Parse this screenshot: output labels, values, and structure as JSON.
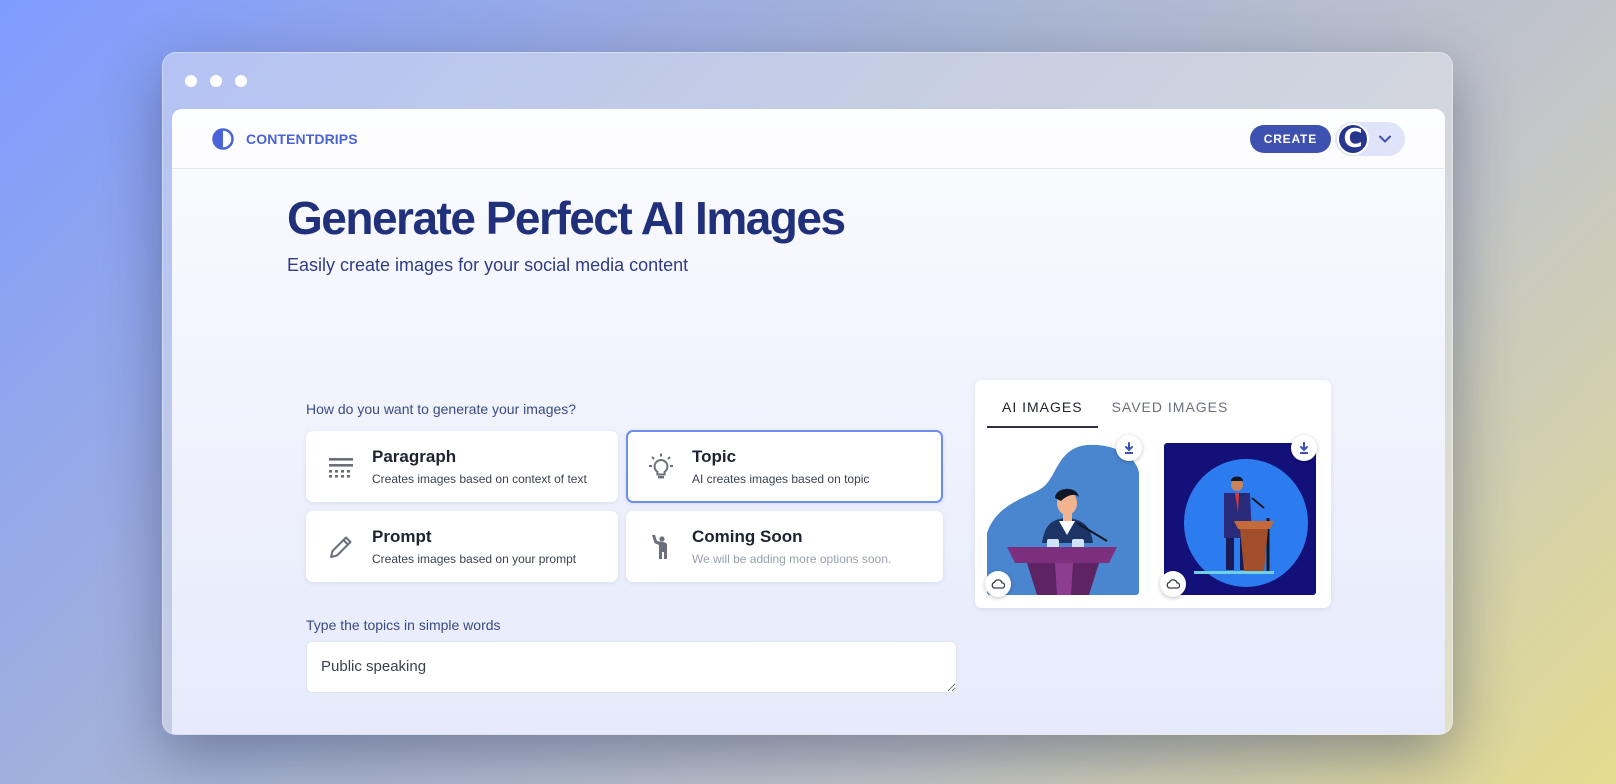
{
  "window": {
    "dots": 3
  },
  "header": {
    "logo_text": "CONTENTDRIPS",
    "create_label": "CREATE",
    "avatar_letter": "C"
  },
  "hero": {
    "title": "Generate Perfect AI Images",
    "subtitle": "Easily create images for your social media content"
  },
  "generate": {
    "question": "How do you want to generate your images?",
    "options": [
      {
        "title": "Paragraph",
        "desc": "Creates images based on context of text",
        "icon": "paragraph-icon",
        "selected": false
      },
      {
        "title": "Topic",
        "desc": "AI creates images based on topic",
        "icon": "lightbulb-icon",
        "selected": true
      },
      {
        "title": "Prompt",
        "desc": "Creates images based on your prompt",
        "icon": "pencil-icon",
        "selected": false
      },
      {
        "title": "Coming Soon",
        "desc": "We will be adding more options soon.",
        "icon": "person-raised-hand-icon",
        "selected": false
      }
    ],
    "topics_label": "Type the topics in simple words",
    "topics_value": "Public speaking"
  },
  "images_panel": {
    "tabs": [
      {
        "label": "AI IMAGES",
        "active": true
      },
      {
        "label": "SAVED IMAGES",
        "active": false
      }
    ],
    "images": [
      {
        "name": "speaker-at-podium-illustration-1",
        "bg": "#ffffff",
        "accent": "#4a86cf"
      },
      {
        "name": "speaker-at-podium-illustration-2",
        "bg": "#13107a",
        "accent": "#2c7cf0"
      }
    ]
  },
  "colors": {
    "brand": "#4a63d8",
    "title": "#21307a",
    "create_button": "#3e50b0",
    "selected_border": "#6b8ef0"
  }
}
